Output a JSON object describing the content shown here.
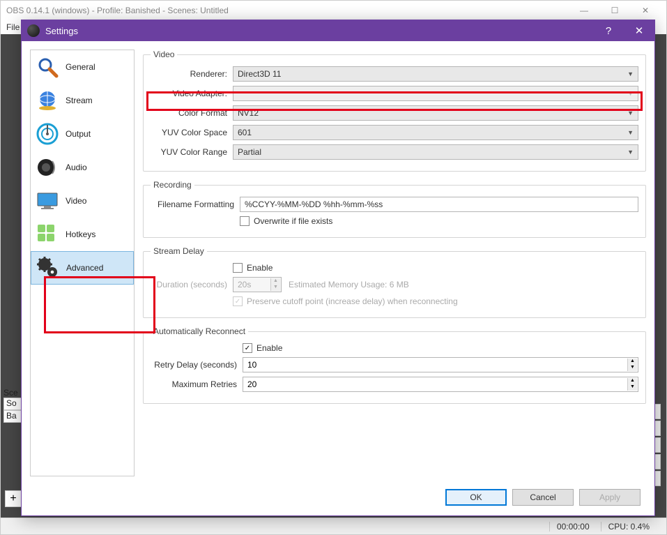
{
  "mainWindow": {
    "title": "OBS 0.14.1 (windows) - Profile: Banished - Scenes: Untitled",
    "menu": "File",
    "sceneLbl": "Sce",
    "src1": "So",
    "src2": "Ba",
    "plus": "+",
    "status_time": "00:00:00",
    "status_cpu": "CPU: 0.4%"
  },
  "dialog": {
    "title": "Settings",
    "help": "?",
    "close": "✕",
    "sidebar": [
      {
        "label": "General"
      },
      {
        "label": "Stream"
      },
      {
        "label": "Output"
      },
      {
        "label": "Audio"
      },
      {
        "label": "Video"
      },
      {
        "label": "Hotkeys"
      },
      {
        "label": "Advanced"
      }
    ],
    "video": {
      "legend": "Video",
      "renderer_lbl": "Renderer:",
      "renderer_val": "Direct3D 11",
      "adapter_lbl": "Video Adapter:",
      "adapter_val": "",
      "colorfmt_lbl": "Color Format",
      "colorfmt_val": "NV12",
      "yuvspace_lbl": "YUV Color Space",
      "yuvspace_val": "601",
      "yuvrange_lbl": "YUV Color Range",
      "yuvrange_val": "Partial"
    },
    "recording": {
      "legend": "Recording",
      "filename_lbl": "Filename Formatting",
      "filename_val": "%CCYY-%MM-%DD %hh-%mm-%ss",
      "overwrite_lbl": "Overwrite if file exists"
    },
    "delay": {
      "legend": "Stream Delay",
      "enable_lbl": "Enable",
      "duration_lbl": "Duration (seconds)",
      "duration_val": "20s",
      "memory_lbl": "Estimated Memory Usage: 6 MB",
      "preserve_lbl": "Preserve cutoff point (increase delay) when reconnecting"
    },
    "reconnect": {
      "legend": "Automatically Reconnect",
      "enable_lbl": "Enable",
      "retry_lbl": "Retry Delay (seconds)",
      "retry_val": "10",
      "max_lbl": "Maximum Retries",
      "max_val": "20"
    },
    "buttons": {
      "ok": "OK",
      "cancel": "Cancel",
      "apply": "Apply"
    }
  }
}
